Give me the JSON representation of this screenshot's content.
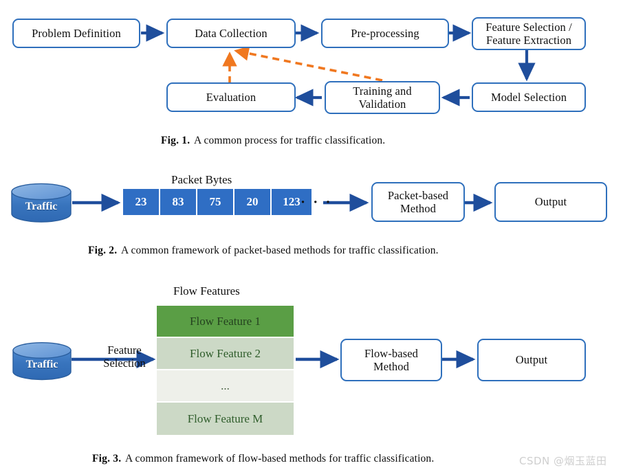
{
  "colors": {
    "box_border": "#2e6fbc",
    "arrow_blue": "#1f4e9c",
    "arrow_orange": "#f07820",
    "cylinder_body": "#3874bd",
    "cylinder_top": "#6b9ddc",
    "byte_fill": "#2f6ec4",
    "flow_row_active": "#5a9e45",
    "flow_row_light": "#ccd9c6",
    "flow_row_faint": "#eef0ea",
    "flow_text": "#2f5d2b",
    "watermark": "#cfcfcf"
  },
  "figure1": {
    "boxes": [
      {
        "id": "problem-definition",
        "label": "Problem Definition"
      },
      {
        "id": "data-collection",
        "label": "Data Collection"
      },
      {
        "id": "pre-processing",
        "label": "Pre-processing"
      },
      {
        "id": "feature-selection-extraction",
        "line1": "Feature Selection /",
        "line2": "Feature Extraction"
      },
      {
        "id": "model-selection",
        "label": "Model Selection"
      },
      {
        "id": "training-validation",
        "line1": "Training and",
        "line2": "Validation"
      },
      {
        "id": "evaluation",
        "label": "Evaluation"
      }
    ],
    "caption": {
      "tag": "Fig. 1.",
      "text": "A common process for traffic classification."
    }
  },
  "figure2": {
    "source_label": "Traffic",
    "section_title": "Packet Bytes",
    "bytes": [
      "23",
      "83",
      "75",
      "20",
      "123"
    ],
    "bytes_ellipsis": "· · ·",
    "method": {
      "line1": "Packet-based",
      "line2": "Method"
    },
    "output_label": "Output",
    "caption": {
      "tag": "Fig. 2.",
      "text": "A common framework of packet-based methods for traffic classification."
    }
  },
  "figure3": {
    "source_label": "Traffic",
    "edge_label": {
      "line1": "Feature",
      "line2": "Selection"
    },
    "section_title": "Flow  Features",
    "flow_rows": [
      {
        "label": "Flow Feature 1",
        "state": "active"
      },
      {
        "label": "Flow Feature 2",
        "state": "light"
      },
      {
        "label": "...",
        "state": "faint"
      },
      {
        "label": "Flow Feature M",
        "state": "light"
      }
    ],
    "method": {
      "line1": "Flow-based",
      "line2": "Method"
    },
    "output_label": "Output",
    "caption": {
      "tag": "Fig. 3.",
      "text": "A common framework of flow-based methods for traffic classification."
    }
  },
  "watermark": "CSDN @烟玉蓝田"
}
